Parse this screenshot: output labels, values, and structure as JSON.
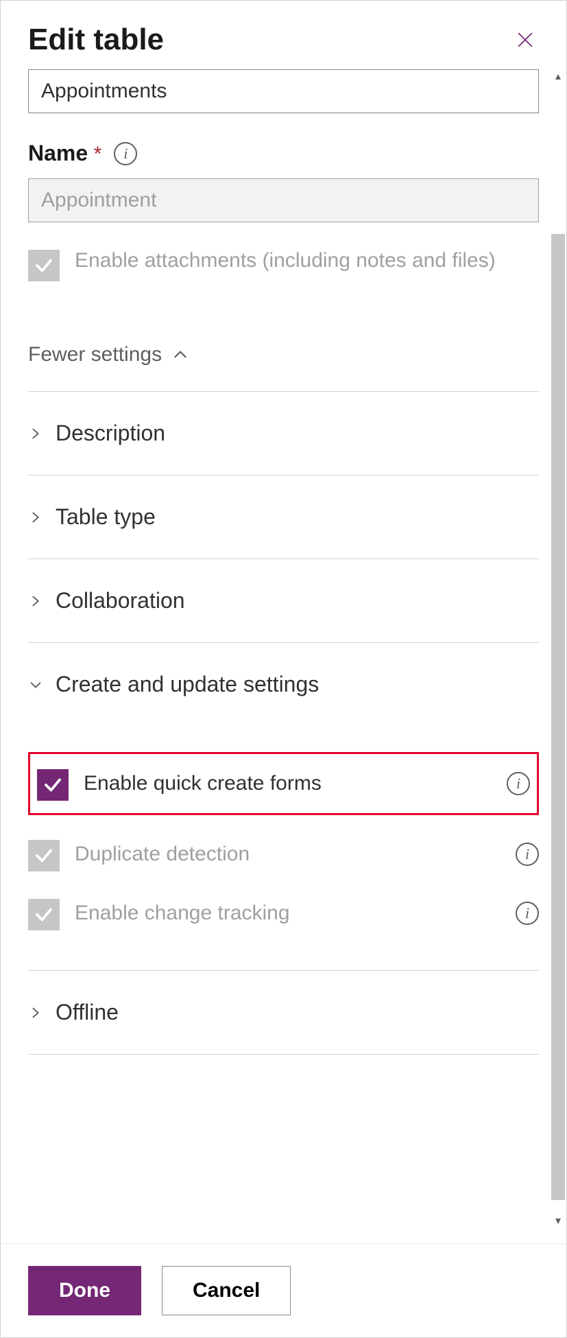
{
  "header": {
    "title": "Edit table"
  },
  "displayName": {
    "value": "Appointments"
  },
  "name": {
    "label": "Name",
    "value": "Appointment"
  },
  "attachments": {
    "label": "Enable attachments (including notes and files)"
  },
  "settingsToggle": {
    "label": "Fewer settings"
  },
  "sections": {
    "description": "Description",
    "tableType": "Table type",
    "collaboration": "Collaboration",
    "createUpdate": "Create and update settings",
    "offline": "Offline"
  },
  "options": {
    "quickCreate": "Enable quick create forms",
    "duplicate": "Duplicate detection",
    "changeTracking": "Enable change tracking"
  },
  "footer": {
    "done": "Done",
    "cancel": "Cancel"
  }
}
